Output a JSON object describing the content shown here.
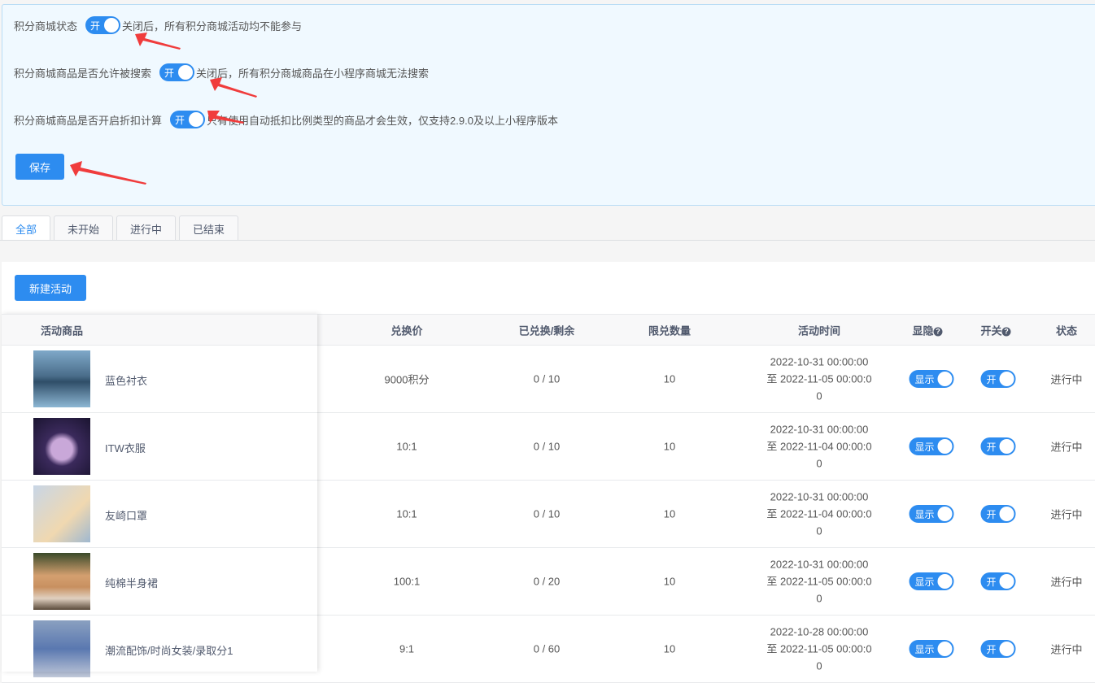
{
  "settings": [
    {
      "label": "积分商城状态",
      "switch": "开",
      "hint": "关闭后，所有积分商城活动均不能参与"
    },
    {
      "label": "积分商城商品是否允许被搜索",
      "switch": "开",
      "hint": "关闭后，所有积分商城商品在小程序商城无法搜索"
    },
    {
      "label": "积分商城商品是否开启折扣计算",
      "switch": "开",
      "hint": "只有使用自动抵扣比例类型的商品才会生效，仅支持2.9.0及以上小程序版本"
    }
  ],
  "save_label": "保存",
  "tabs": [
    "全部",
    "未开始",
    "进行中",
    "已结束"
  ],
  "new_button": "新建活动",
  "columns": [
    "活动商品",
    "兑换价",
    "已兑换/剩余",
    "限兑数量",
    "活动时间",
    "显隐",
    "开关",
    "状态"
  ],
  "help_icon": "?",
  "rows": [
    {
      "name": "蓝色衬衣",
      "price": "9000积分",
      "exchanged": "0 / 10",
      "limit": "10",
      "time1": "2022-10-31 00:00:00",
      "time2": "至 2022-11-05 00:00:0",
      "time3": "0",
      "visible": "显示",
      "toggle": "开",
      "status": "进行中"
    },
    {
      "name": "ITW衣服",
      "price": "10:1",
      "exchanged": "0 / 10",
      "limit": "10",
      "time1": "2022-10-31 00:00:00",
      "time2": "至 2022-11-04 00:00:0",
      "time3": "0",
      "visible": "显示",
      "toggle": "开",
      "status": "进行中"
    },
    {
      "name": "友崎口罩",
      "price": "10:1",
      "exchanged": "0 / 10",
      "limit": "10",
      "time1": "2022-10-31 00:00:00",
      "time2": "至 2022-11-04 00:00:0",
      "time3": "0",
      "visible": "显示",
      "toggle": "开",
      "status": "进行中"
    },
    {
      "name": "纯棉半身裙",
      "price": "100:1",
      "exchanged": "0 / 20",
      "limit": "10",
      "time1": "2022-10-31 00:00:00",
      "time2": "至 2022-11-05 00:00:0",
      "time3": "0",
      "visible": "显示",
      "toggle": "开",
      "status": "进行中"
    },
    {
      "name": "潮流配饰/时尚女装/录取分1",
      "price": "9:1",
      "exchanged": "0 / 60",
      "limit": "10",
      "time1": "2022-10-28 00:00:00",
      "time2": "至 2022-11-05 00:00:0",
      "time3": "0",
      "visible": "显示",
      "toggle": "开",
      "status": "进行中"
    }
  ],
  "colors": {
    "primary": "#2d8cf0",
    "arrow": "#f03c3c"
  }
}
